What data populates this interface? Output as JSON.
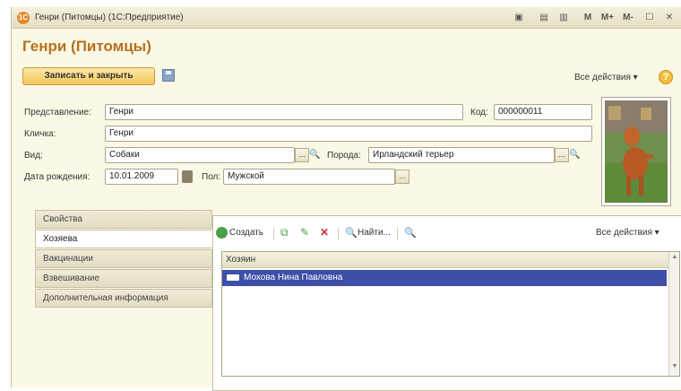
{
  "window": {
    "title": "Генри (Питомцы) (1С:Предприятие)",
    "app_icon_label": "1С",
    "titlebar_buttons": [
      "M",
      "M+",
      "M-"
    ]
  },
  "form": {
    "title": "Генри (Питомцы)",
    "save_close_label": "Записать и закрыть",
    "all_actions_label": "Все действия ▾",
    "help_label": "?"
  },
  "fields": {
    "presentation": {
      "label": "Представление:",
      "value": "Генри"
    },
    "code": {
      "label": "Код:",
      "value": "000000011"
    },
    "nickname": {
      "label": "Кличка:",
      "value": "Генри"
    },
    "species": {
      "label": "Вид:",
      "value": "Собаки"
    },
    "breed": {
      "label": "Порода:",
      "value": "Ирландский терьер"
    },
    "birth_date": {
      "label": "Дата рождения:",
      "value": "10.01.2009"
    },
    "sex": {
      "label": "Пол:",
      "value": "Мужской"
    }
  },
  "tabs": [
    {
      "label": "Свойства",
      "active": false
    },
    {
      "label": "Хозяева",
      "active": true
    },
    {
      "label": "Вакцинации",
      "active": false
    },
    {
      "label": "Взвешивание",
      "active": false
    },
    {
      "label": "Дополнительная информация",
      "active": false
    }
  ],
  "owners_panel": {
    "create_label": "Создать",
    "find_label": "Найти...",
    "all_actions_label": "Все действия ▾",
    "columns": [
      "Хозяин"
    ],
    "rows": [
      {
        "owner": "Мохова Нина Павловна",
        "selected": true
      }
    ]
  },
  "colors": {
    "title_accent": "#b7711d",
    "selected_row": "#3d4fa8",
    "button_fill": "#f2c758"
  }
}
